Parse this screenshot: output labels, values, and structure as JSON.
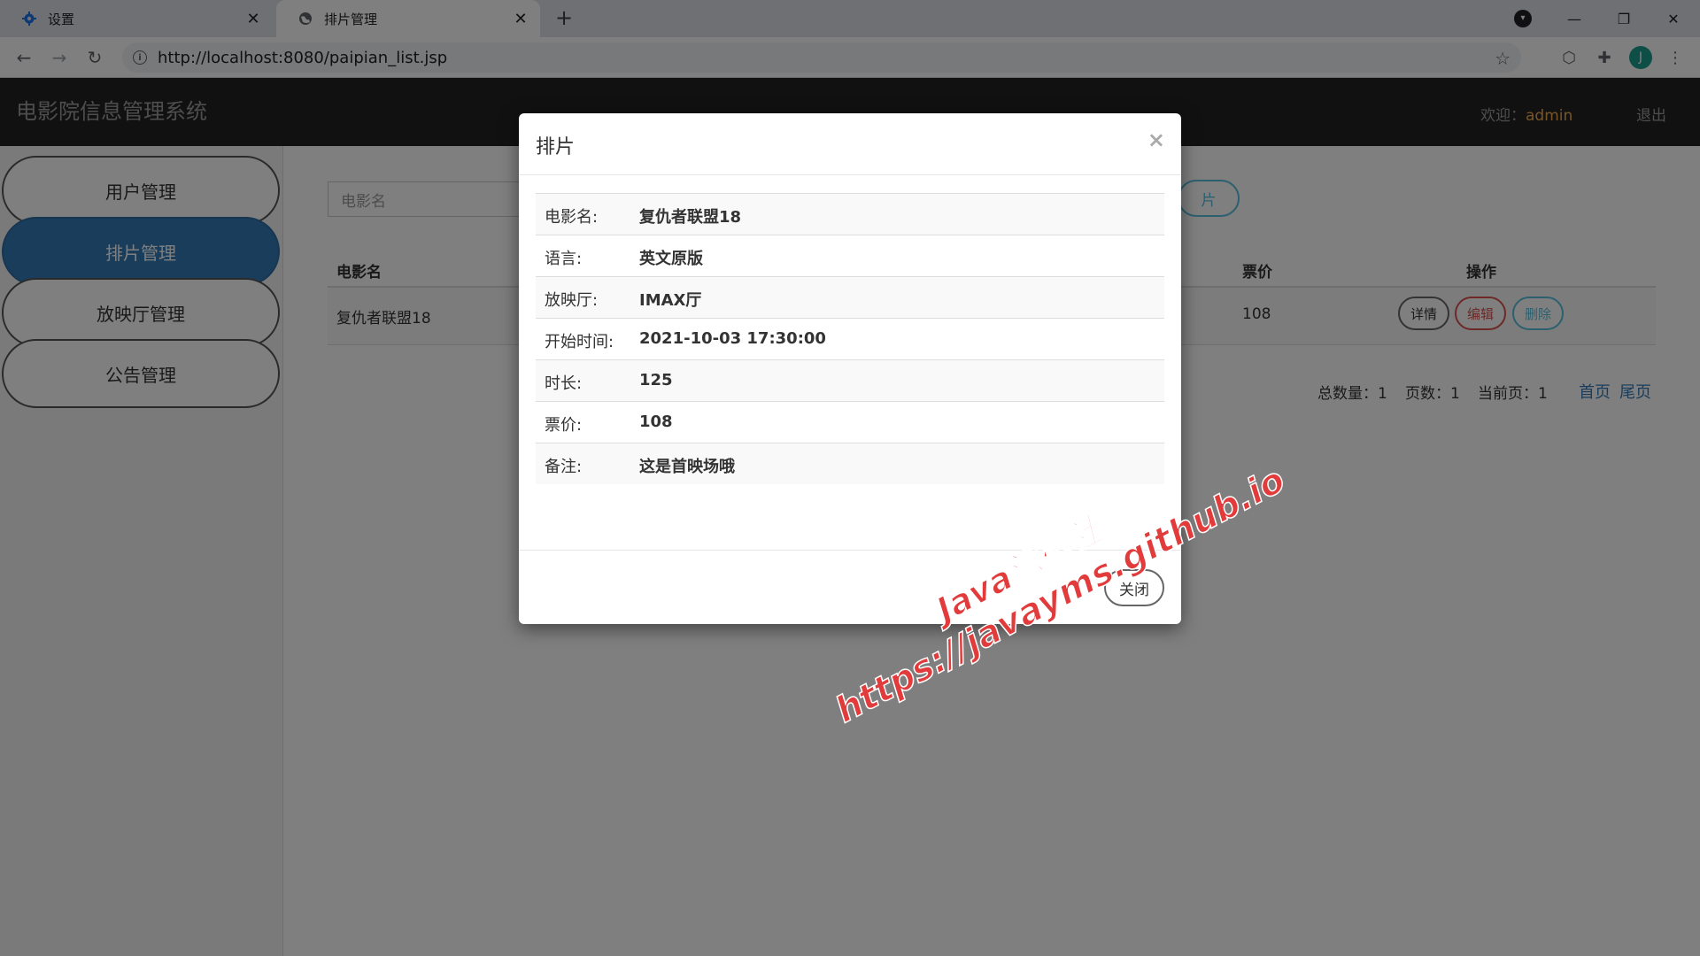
{
  "browser": {
    "tabs": [
      {
        "label": "设置",
        "icon": "gear-icon"
      },
      {
        "label": "排片管理",
        "icon": "globe-icon"
      }
    ],
    "url": "http://localhost:8080/paipian_list.jsp",
    "profile_initial": "J"
  },
  "app": {
    "brand": "电影院信息管理系统",
    "welcome_label": "欢迎：",
    "username": "admin",
    "logout": "退出"
  },
  "sidebar": {
    "items": [
      {
        "label": "用户管理"
      },
      {
        "label": "排片管理"
      },
      {
        "label": "放映厅管理"
      },
      {
        "label": "公告管理"
      }
    ]
  },
  "list": {
    "search_placeholder": "电影名",
    "add_button_visible": "片",
    "columns": {
      "movie": "电影名",
      "price": "票价",
      "ops": "操作"
    },
    "rows": [
      {
        "movie": "复仇者联盟18",
        "price": "108"
      }
    ],
    "ops": {
      "detail": "详情",
      "edit": "编辑",
      "delete": "删除"
    },
    "pager": {
      "total": "总数量：1",
      "pages": "页数：1",
      "current": "当前页：1",
      "first": "首页",
      "last": "尾页"
    }
  },
  "modal": {
    "title": "排片",
    "close_x": "×",
    "fields": [
      {
        "label": "电影名:",
        "value": "复仇者联盟18"
      },
      {
        "label": "语言:",
        "value": "英文原版"
      },
      {
        "label": "放映厅:",
        "value": "IMAX厅"
      },
      {
        "label": "开始时间:",
        "value": "2021-10-03 17:30:00"
      },
      {
        "label": "时长:",
        "value": "125"
      },
      {
        "label": "票价:",
        "value": "108"
      },
      {
        "label": "备注:",
        "value": "这是首映场哦"
      }
    ],
    "close_button": "关闭"
  },
  "watermark": {
    "line1": "Java源码社",
    "line2": "https://javayms.github.io"
  }
}
